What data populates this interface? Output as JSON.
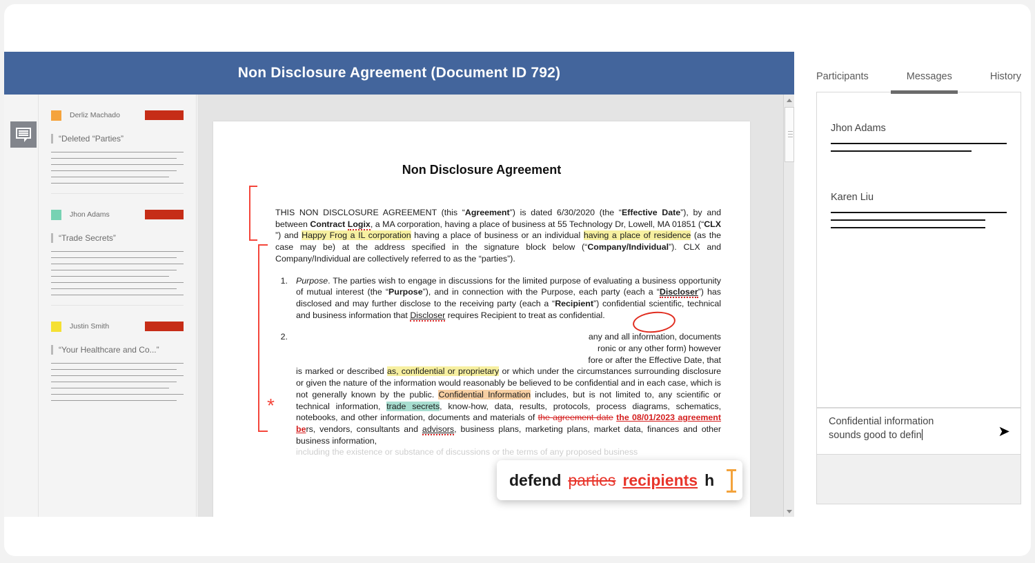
{
  "header": {
    "title": "Non Disclosure Agreement (Document ID 792)",
    "banner_color": "#43659c"
  },
  "left_rail": {
    "comments_toggle_icon": "comment-bubble-icon"
  },
  "comments_pane": {
    "comments": [
      {
        "author": "Derliz Machado",
        "avatar_color": "#f5a33c",
        "status_color": "#c62d17",
        "quote": "“Deleted “Parties”",
        "body_lines": 6
      },
      {
        "author": "Jhon Adams",
        "avatar_color": "#77d2b3",
        "status_color": "#c62d17",
        "quote": "“Trade Secrets”",
        "body_lines": 8
      },
      {
        "author": "Justin Smith",
        "avatar_color": "#f5e033",
        "status_color": "#c62d17",
        "quote": "“Your Healthcare and Co...”",
        "body_lines": 7
      }
    ]
  },
  "document": {
    "title": "Non Disclosure Agreement",
    "preamble": {
      "p1": "THIS NON DISCLOSURE AGREEMENT (this “",
      "agreement_b": "Agreement",
      "p2": "”) is dated 6/30/2020 (the “",
      "effective_b": "Effective Date",
      "p3": "”), by and between ",
      "contract_b": "Contract ",
      "logix_b": "Logix",
      "p4": ", a MA corporation, having a place of business at 55 Technology Dr, Lowell, MA 01851  (“",
      "clx_b": "CLX ",
      "p5": "”) and ",
      "hl_company": "Happy Frog a IL corporation",
      "p6": " having a place of business or an individual ",
      "hl_residence": "having a place of residence",
      "p7": " (as the case may be) at the address specified in the signature block below (“",
      "companyind_b": "Company/Individual",
      "p8": "”). CLX and Company/Individual are collectively referred to as the “parties”)."
    },
    "section1": {
      "number": "1.",
      "heading": "Purpose",
      "t1": ".  The parties wish to engage in discussions for the limited purpose of evaluating a business opportunity of mutual interest (the “",
      "purpose_b": "Purpose",
      "t2": "”), and in connection with the Purpose, each party (each a “",
      "discloser_b": "Discloser",
      "t3": "”) has disclosed and may further disclose to the receiving party (each a “",
      "recipient_b": "Recipient",
      "t4": "”) confidential scientific, technical and business information that ",
      "discloser_u": "Discloser",
      "t5": " requires Recipient to treat as confidential."
    },
    "section2": {
      "number": "2.",
      "hidden_l1": "any and all information, documents",
      "hidden_l2": "ronic or any other form) however",
      "hidden_l3": "fore or after the Effective Date, that",
      "t1": "is marked or described ",
      "hl_confidential": "as, confidential or proprietary",
      "t2": " or which under the circumstances surrounding disclosure or given the nature of the information would reasonably be believed to be confidential and in each case, which is not generally known by the public. ",
      "hl_confinfo": "Confidential Information",
      "t3": " includes, but is not limited to, any scientific or technical information, ",
      "hl_tradesecrets": "trade secrets",
      "t4": ", know-how, data, results, protocols, process diagrams, schematics, notebooks, and other information, documents and materials of ",
      "del_agreementdate": "the agreement date",
      "ins_agreementdate": "the 08/01/2023 agreement be",
      "t5": "rs, vendors, consultants and ",
      "advisors_u": "advisors",
      "t6": ", business plans, marketing plans, market data, finances and other business information,"
    },
    "section2_cut": "including the existence or substance of discussions or the terms of any proposed business",
    "annotation_circle": "red-ellipse-around-parties",
    "change_marker": "*"
  },
  "edit_popup": {
    "word": "defend",
    "deleted": "parties",
    "inserted": "recipients",
    "tail": "h",
    "cursor_icon": "i-beam-cursor"
  },
  "scrollbar": {
    "up_icon": "scroll-up-arrow-icon",
    "down_icon": "scroll-down-arrow-icon"
  },
  "chat_panel": {
    "tabs": [
      {
        "label": "Participants",
        "active": false
      },
      {
        "label": "Messages",
        "active": true
      },
      {
        "label": "History",
        "active": false
      }
    ],
    "messages": [
      {
        "author": "Jhon Adams",
        "line_count": 2
      },
      {
        "author": "Karen Liu",
        "line_count": 3
      }
    ],
    "composer": {
      "value_line1": "Confidential information",
      "value_line2": "sounds good to defin",
      "send_icon": "send-arrow-icon",
      "send_glyph": "➤"
    }
  }
}
